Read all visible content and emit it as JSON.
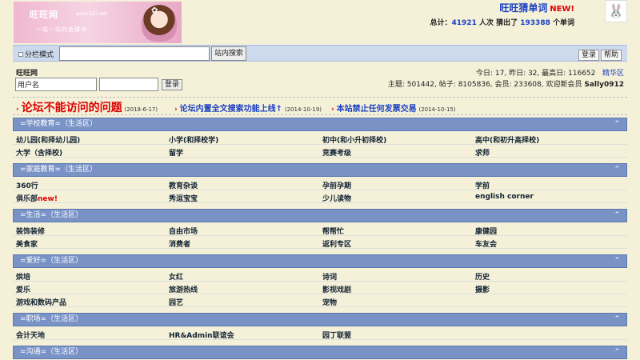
{
  "banner": {
    "logo": "旺旺网",
    "logo_sub": "www.123.net",
    "slogan": "一站一站的金碟帅"
  },
  "game": {
    "title": "旺旺猜单词",
    "new": "NEW!",
    "stats_prefix": "总计：",
    "visits": "41921",
    "visits_unit": "人次 猜出了",
    "words": "193388",
    "words_unit": "个单词"
  },
  "search": {
    "split_label": "分栏模式",
    "button": "站内搜索",
    "login": "登录",
    "help": "帮助"
  },
  "login": {
    "site_name": "旺旺网",
    "username_placeholder": "用户名",
    "button": "登录"
  },
  "stats": {
    "line1": "今日: 17, 昨日: 32, 最高日: 116652",
    "elite": "精华区",
    "line2": "主题: 501442, 帖子: 8105836, 会员: 233608, 欢迎新会员",
    "new_member": "Sally0912"
  },
  "announcements": [
    {
      "text": "论坛不能访问的问题",
      "date": "(2018-6-17)"
    },
    {
      "text": "论坛内置全文搜索功能上线↑",
      "date": "(2014-10-19)"
    },
    {
      "text": "本站禁止任何发票交易",
      "date": "(2014-10-15)"
    }
  ],
  "sections": [
    {
      "title": "=学校教育=（生活区）",
      "rows": [
        [
          "幼儿园(和择幼儿园)",
          "小学(和择校学)",
          "初中(和小升初择校)",
          "高中(和初升高择校)"
        ],
        [
          "大学（含择校)",
          "留学",
          "竞赛考级",
          "求师"
        ]
      ]
    },
    {
      "title": "=家庭教育=（生活区）",
      "rows": [
        [
          "360行",
          "教育杂谈",
          "孕前孕期",
          "学前"
        ],
        [
          "俱乐部",
          "秀逗宝宝",
          "少儿读物",
          "english corner"
        ]
      ],
      "new_label": "new!"
    },
    {
      "title": "=生活=（生活区）",
      "rows": [
        [
          "装饰装修",
          "自由市场",
          "帮帮忙",
          "康健园"
        ],
        [
          "美食家",
          "消费者",
          "返利专区",
          "车友会"
        ]
      ]
    },
    {
      "title": "=爱好=（生活区）",
      "rows": [
        [
          "烘培",
          "女红",
          "诗词",
          "历史"
        ],
        [
          "爱乐",
          "旅游热线",
          "影视戏剧",
          "摄影"
        ],
        [
          "游戏和数码产品",
          "园艺",
          "宠物",
          ""
        ]
      ]
    },
    {
      "title": "=职场=（生活区）",
      "rows": [
        [
          "会计天地",
          "HR&Admin联谊会",
          "园丁联盟",
          ""
        ]
      ]
    },
    {
      "title": "=沟通=（生活区）",
      "rows": []
    }
  ]
}
